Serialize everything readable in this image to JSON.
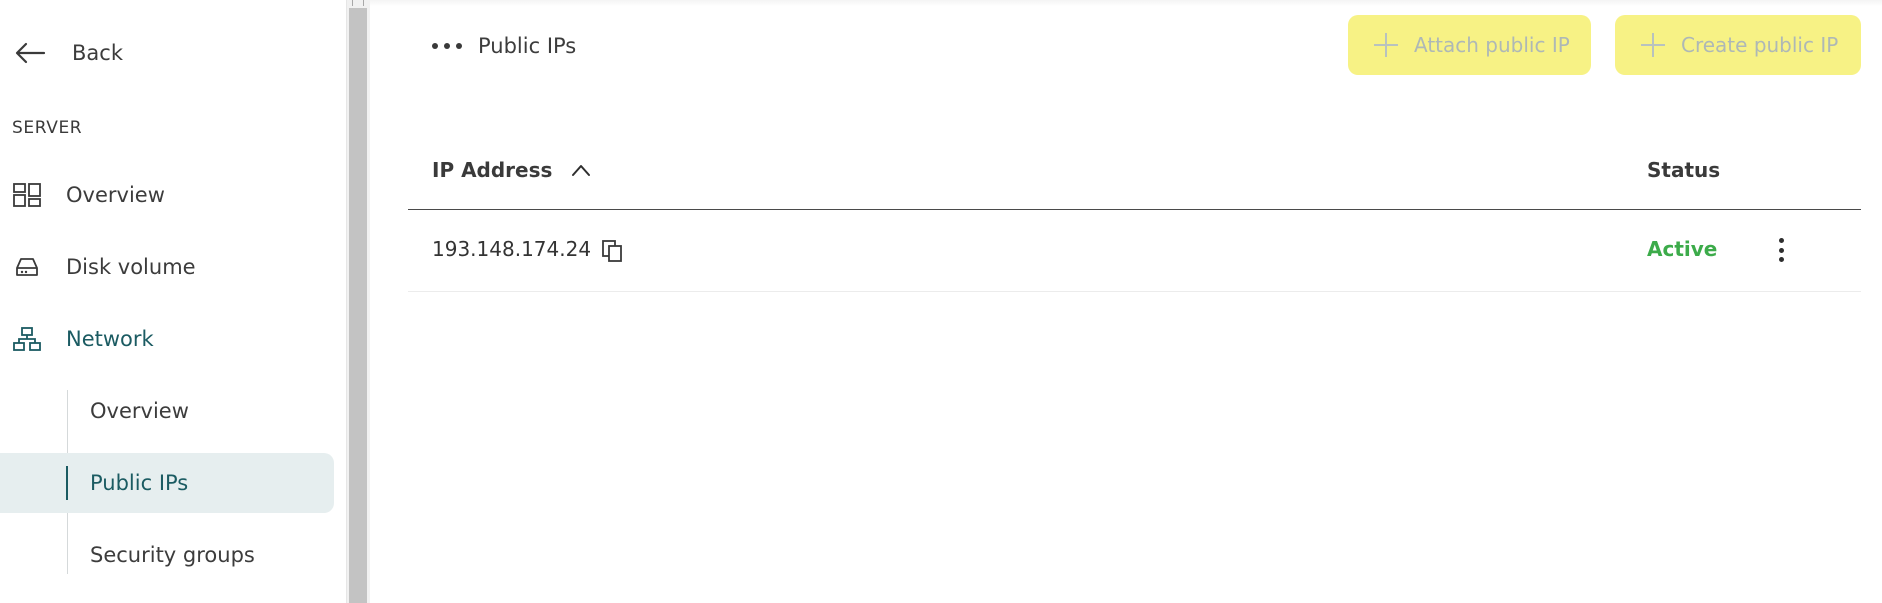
{
  "sidebar": {
    "back_label": "Back",
    "section_title": "SERVER",
    "items": [
      {
        "label": "Overview",
        "icon": "dashboard-icon"
      },
      {
        "label": "Disk volume",
        "icon": "disk-drive-icon"
      },
      {
        "label": "Network",
        "icon": "network-icon",
        "active": true
      }
    ],
    "sub_items": [
      {
        "label": "Overview"
      },
      {
        "label": "Public IPs",
        "selected": true
      },
      {
        "label": "Security groups"
      }
    ]
  },
  "header": {
    "breadcrumb_label": "Public IPs",
    "attach_button": "Attach public IP",
    "create_button": "Create public IP"
  },
  "table": {
    "columns": {
      "ip": "IP Address",
      "status": "Status"
    },
    "sort": "ascending",
    "rows": [
      {
        "ip": "193.148.174.24",
        "status": "Active"
      }
    ]
  },
  "colors": {
    "accent": "#1b5b62",
    "button_bg": "#f7f285",
    "status_active": "#3cab4a",
    "selected_bg": "#e6eeef"
  }
}
